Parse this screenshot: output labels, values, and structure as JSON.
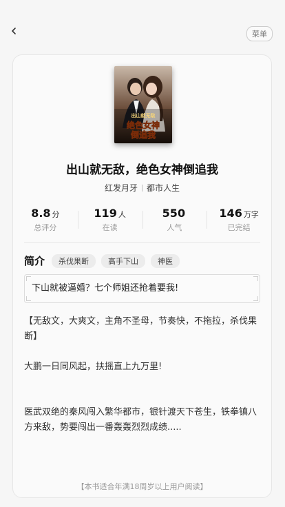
{
  "header": {
    "menu_label": "菜单"
  },
  "book": {
    "cover_title": "绝色女神倒追我",
    "cover_prefix": "出山就无敌",
    "title": "出山就无敌，绝色女神倒追我",
    "author": "红发月牙",
    "category": "都市人生"
  },
  "stats": [
    {
      "value": "8.8",
      "unit": "分",
      "label": "总评分"
    },
    {
      "value": "119",
      "unit": "人",
      "label": "在读"
    },
    {
      "value": "550",
      "unit": "",
      "label": "人气"
    },
    {
      "value": "146",
      "unit": "万字",
      "label": "已完结"
    }
  ],
  "intro": {
    "label": "简介",
    "tags": [
      "杀伐果断",
      "高手下山",
      "神医"
    ],
    "quote": "下山就被逼婚？七个师姐还抢着要我!",
    "paragraphs": [
      "【无敌文，大爽文，主角不圣母，节奏快，不拖拉，杀伐果断】",
      "大鹏一日同风起，扶摇直上九万里!",
      "医武双绝的秦风闯入繁华都市，银针渡天下苍生，铁拳镇八方来敌，势要闯出一番轰轰烈烈成绩....."
    ]
  },
  "notice": "【本书适合年满18周岁以上用户阅读】"
}
